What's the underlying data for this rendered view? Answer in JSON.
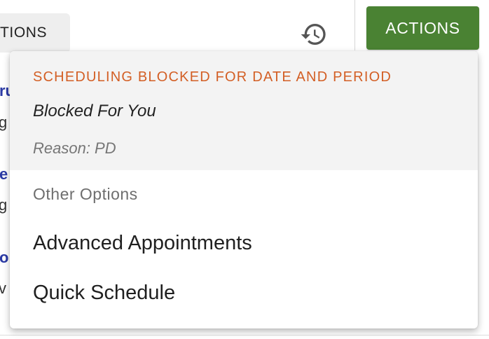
{
  "toolbar": {
    "options_label": "TIONS",
    "history_icon": "history-icon",
    "actions_label": "ACTIONS",
    "accent_color": "#4a8233"
  },
  "background_list": {
    "fragments": [
      {
        "text": "ru",
        "style": "title"
      },
      {
        "text": "g",
        "style": "sub"
      },
      {
        "text": "e",
        "style": "title"
      },
      {
        "text": "g",
        "style": "sub"
      },
      {
        "text": "o",
        "style": "title"
      },
      {
        "text": "v",
        "style": "sub"
      }
    ]
  },
  "menu": {
    "blocked": {
      "heading": "SCHEDULING BLOCKED FOR DATE AND PERIOD",
      "blocked_for": "Blocked For You",
      "reason": "Reason: PD",
      "heading_color": "#d35f25"
    },
    "other_options": {
      "heading": "Other Options",
      "items": [
        {
          "label": "Advanced Appointments"
        },
        {
          "label": "Quick Schedule"
        }
      ]
    }
  }
}
